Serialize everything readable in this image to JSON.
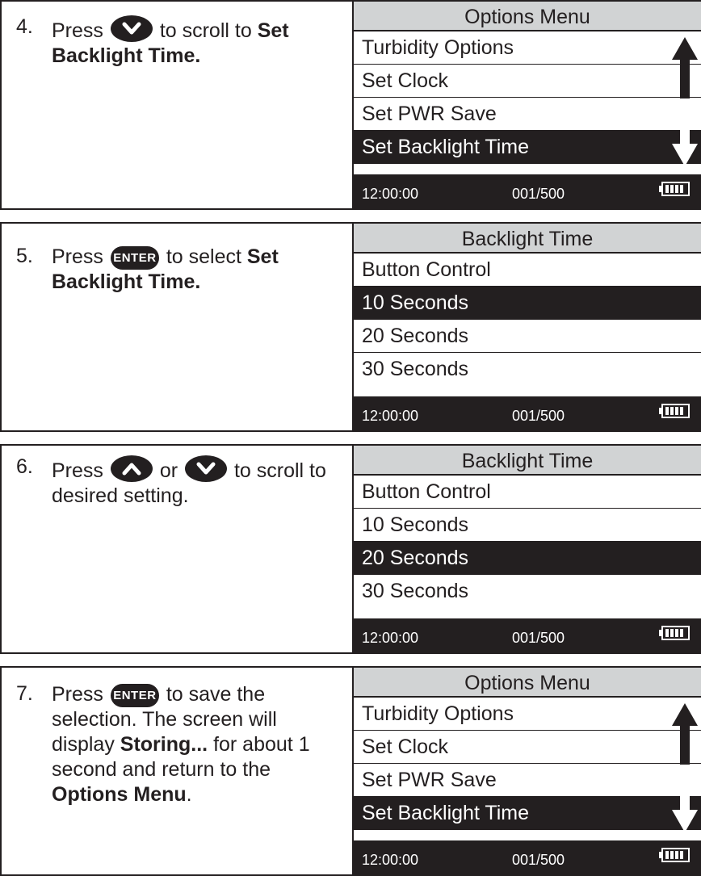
{
  "steps": [
    {
      "number": "4.",
      "text_pre": "Press",
      "button_1": "down-arrow",
      "text_mid": "to scroll to",
      "bold_1": "Set Backlight Time.",
      "screen": {
        "title": "Options Menu",
        "rows": [
          "Turbidity Options",
          "Set Clock",
          "Set PWR Save",
          "Set Backlight Time"
        ],
        "selected_index": 3,
        "scroll_arrows": true,
        "time": "12:00:00",
        "count": "001/500"
      }
    },
    {
      "number": "5.",
      "text_pre": "Press",
      "button_1": "ENTER",
      "text_mid": "to select",
      "bold_1": "Set Backlight Time.",
      "screen": {
        "title": "Backlight Time",
        "rows": [
          "Button Control",
          "10 Seconds",
          "20 Seconds",
          "30 Seconds"
        ],
        "selected_index": 1,
        "scroll_arrows": false,
        "time": "12:00:00",
        "count": "001/500"
      }
    },
    {
      "number": "6.",
      "text_pre": "Press",
      "button_1": "up-arrow",
      "text_or": "or",
      "button_2": "down-arrow",
      "text_mid": "to scroll to desired setting.",
      "screen": {
        "title": "Backlight Time",
        "rows": [
          "Button Control",
          "10 Seconds",
          "20 Seconds",
          "30 Seconds"
        ],
        "selected_index": 2,
        "scroll_arrows": false,
        "time": "12:00:00",
        "count": "001/500"
      }
    },
    {
      "number": "7.",
      "text_pre": "Press",
      "button_1": "ENTER",
      "text_mid": "to save the selection. The screen will display",
      "bold_1": "Storing...",
      "text_after": "for about 1 second and return to the",
      "bold_2": "Options Menu",
      "text_end": ".",
      "screen": {
        "title": "Options Menu",
        "rows": [
          "Turbidity Options",
          "Set Clock",
          "Set PWR Save",
          "Set Backlight Time"
        ],
        "selected_index": 3,
        "scroll_arrows": true,
        "time": "12:00:00",
        "count": "001/500"
      }
    }
  ],
  "enter_label": "ENTER",
  "colors": {
    "ink": "#231f20",
    "title_bar": "#d1d3d4",
    "background": "#ffffff"
  }
}
